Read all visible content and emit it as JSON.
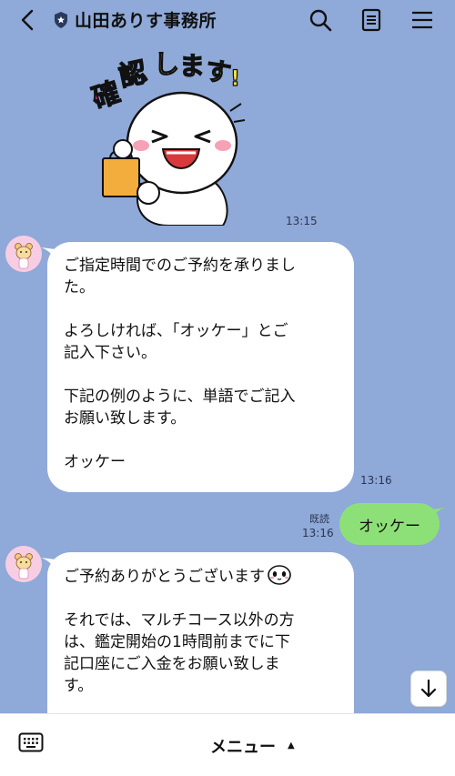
{
  "header": {
    "title": "山田ありす事務所",
    "back_icon": "chevron-left-icon",
    "verified_icon": "shield-icon",
    "actions": [
      "search-icon",
      "note-icon",
      "hamburger-icon"
    ]
  },
  "messages": [
    {
      "type": "sticker",
      "sticker_text": "確認します!",
      "time": "13:15"
    },
    {
      "type": "incoming",
      "lines_p1": [
        "ご指定時間でのご予約を承りまし",
        "た。"
      ],
      "lines_p2": [
        "よろしければ、「オッケー」とご",
        "記入下さい。"
      ],
      "lines_p3": [
        "下記の例のように、単語でご記入",
        "お願い致します。"
      ],
      "lines_p4": [
        "オッケー"
      ],
      "time": "13:16"
    },
    {
      "type": "outgoing",
      "text": "オッケー",
      "read_label": "既読",
      "time": "13:16"
    },
    {
      "type": "incoming",
      "lines_p1": [
        "ご予約ありがとうございます"
      ],
      "lines_p2": [
        "それでは、マルチコース以外の方",
        "は、鑑定開始の1時間前までに下",
        "記口座にご入金をお願い致しま",
        "す。"
      ]
    }
  ],
  "bottom_bar": {
    "menu_label": "メニュー",
    "menu_caret": "▲",
    "keyboard_icon": "keyboard-icon"
  },
  "colors": {
    "background": "#8fa9d8",
    "outgoing_bubble": "#8de077",
    "incoming_bubble": "#ffffff"
  }
}
